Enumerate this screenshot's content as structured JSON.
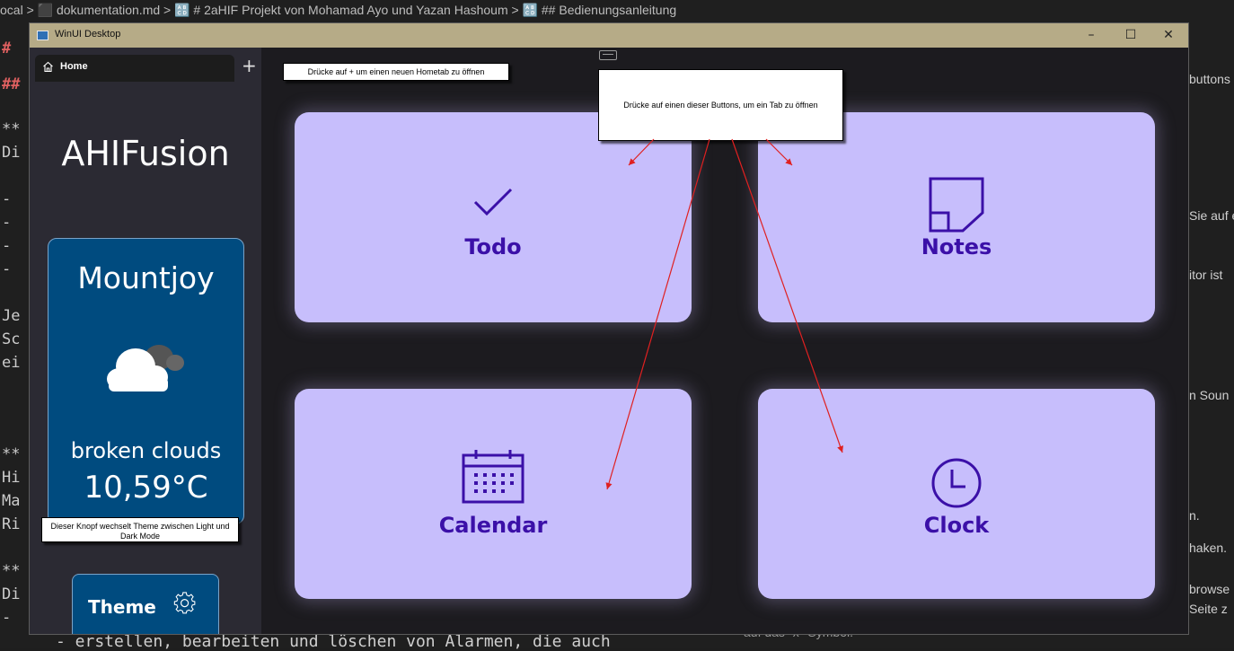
{
  "background": {
    "breadcrumb": "ocal > ⬛ dokumentation.md > 🔠 # 2aHIF Projekt von Mohamad Ayo und Yazan Hashoum > 🔠 ## Bedienungsanleitung",
    "left_lines": [
      "#",
      "##",
      "**",
      "Di",
      "-",
      "-",
      "-",
      "-",
      "Je",
      "Sc",
      "ei",
      "**",
      "Hi",
      "Ma",
      "Ri",
      "**",
      "Di",
      "-"
    ],
    "right_lines": [
      "buttons",
      "Sie auf e",
      "itor ist",
      "n Soun",
      "n.",
      "haken.",
      "browse",
      "Seite z"
    ],
    "bottom_line": "- erstellen, bearbeiten und löschen von Alarmen, die auch",
    "bottom_right": "auf das \"x\"-Symbol."
  },
  "window": {
    "title": "WinUI Desktop",
    "controls": {
      "minimize": "–",
      "maximize": "☐",
      "close": "✕"
    }
  },
  "tabs": {
    "home_label": "Home",
    "add_label": "+"
  },
  "sidebar": {
    "app_title": "AHIFusion",
    "weather": {
      "city": "Mountjoy",
      "icon": "cloud-icon",
      "description": "broken clouds",
      "temperature": "10,59°C"
    },
    "theme_label": "Theme"
  },
  "cards": [
    {
      "label": "Todo",
      "icon": "checkmark-icon"
    },
    {
      "label": "Notes",
      "icon": "note-icon"
    },
    {
      "label": "Calendar",
      "icon": "calendar-icon"
    },
    {
      "label": "Clock",
      "icon": "clock-icon"
    }
  ],
  "annotations": {
    "hometab": "Drücke auf + um einen neuen Hometab zu öffnen",
    "buttons": "Drücke auf einen dieser Buttons, um ein Tab zu öffnen",
    "theme": "Dieser Knopf wechselt Theme zwischen Light und Dark Mode"
  },
  "colors": {
    "card_bg": "#c7befc",
    "card_fg": "#3b10a8",
    "weather_bg": "#004b7f",
    "titlebar": "#b6ab87",
    "arrow": "#e02020"
  }
}
